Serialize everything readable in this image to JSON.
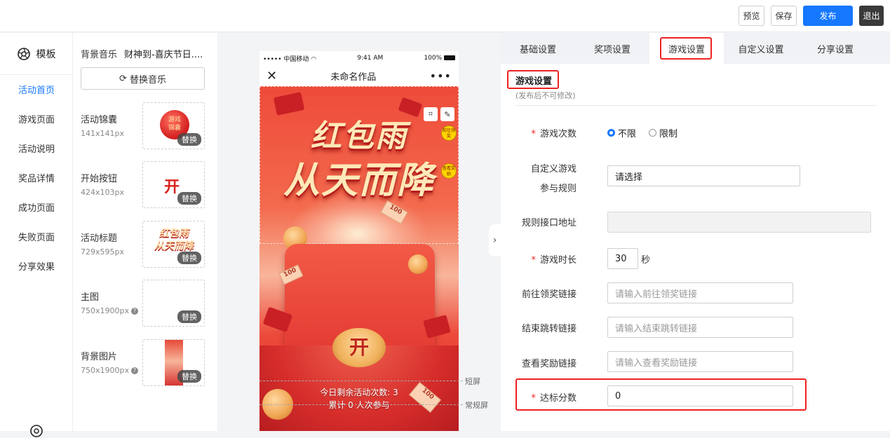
{
  "toolbar": {
    "preview": "预览",
    "save": "保存",
    "publish": "发布",
    "exit": "退出"
  },
  "nav": {
    "header": "模板",
    "items": [
      "活动首页",
      "游戏页面",
      "活动说明",
      "奖品详情",
      "成功页面",
      "失败页面",
      "分享效果"
    ],
    "active_index": 0
  },
  "assets": {
    "music_label": "背景音乐",
    "music_name": "财神到-喜庆节日....",
    "replace_music": "替换音乐",
    "replace_tag": "替换",
    "items": [
      {
        "name": "活动锦囊",
        "size": "141x141px"
      },
      {
        "name": "开始按钮",
        "size": "424x103px"
      },
      {
        "name": "活动标题",
        "size": "729x595px"
      },
      {
        "name": "主图",
        "size": "750x1900px"
      },
      {
        "name": "背景图片",
        "size": "750x1900px"
      }
    ],
    "thumb_texts": {
      "bag": "游戏\n锦囊",
      "kai": "开",
      "title": "红包雨\n从天而降"
    }
  },
  "phone": {
    "carrier": "••••• 中国移动",
    "time": "9:41 AM",
    "battery": "100%",
    "title": "未命名作品",
    "poster_title_line1": "红包雨",
    "poster_title_line2": "从天而降",
    "badge_top": "前往领奖",
    "badge_bottom": "查看奖励",
    "kai": "开",
    "note_value": "100",
    "remaining": "今日剩余活动次数: 3",
    "participants": "累计 0 人次参与"
  },
  "guides": {
    "short": "短屏",
    "normal": "常规屏"
  },
  "tabs": [
    "基础设置",
    "奖项设置",
    "游戏设置",
    "自定义设置",
    "分享设置"
  ],
  "active_tab": 2,
  "section": {
    "title": "游戏设置",
    "subtitle": "(发布后不可修改)"
  },
  "form": {
    "play_count_label": "游戏次数",
    "opt_unlimited": "不限",
    "opt_limited": "限制",
    "custom_rule_label_1": "自定义游戏",
    "custom_rule_label_2": "参与规则",
    "custom_rule_value": "请选择",
    "api_label": "规则接口地址",
    "duration_label": "游戏时长",
    "duration_value": "30",
    "duration_unit": "秒",
    "claim_label": "前往领奖链接",
    "claim_placeholder": "请输入前往领奖链接",
    "end_label": "结束跳转链接",
    "end_placeholder": "请输入结束跳转链接",
    "reward_label": "查看奖励链接",
    "reward_placeholder": "请输入查看奖励链接",
    "score_label": "达标分数",
    "score_value": "0"
  },
  "colors": {
    "accent": "#1677ff",
    "highlight": "#ee2222",
    "poster_red": "#e33a33"
  }
}
